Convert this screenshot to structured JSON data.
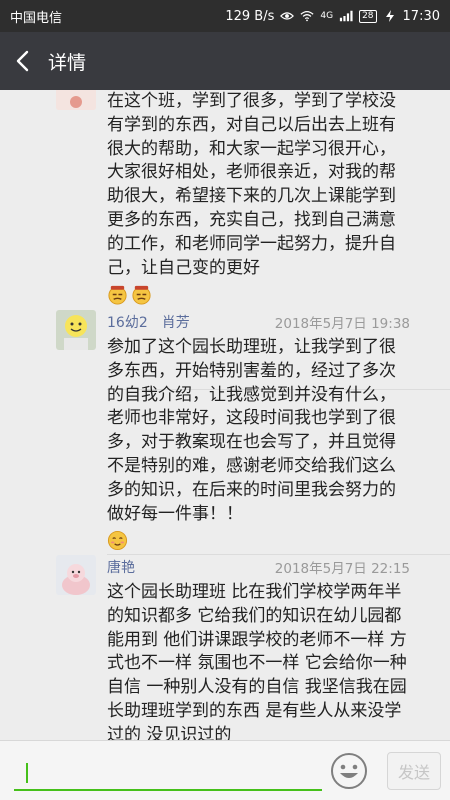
{
  "status_bar": {
    "carrier": "中国电信",
    "speed": "129 B/s",
    "network": "4G",
    "battery": "28",
    "time": "17:30"
  },
  "header": {
    "title": "详情",
    "back_icon": "chevron-left-icon"
  },
  "comments": [
    {
      "name": "",
      "time": "",
      "text": "在这个班，学到了很多，学到了学校没有学到的东西，对自己以后出去上班有很大的帮助，和大家一起学习很开心，大家很好相处，老师很亲近，对我的帮助很大，希望接下来的几次上课能学到更多的东西，充实自己，找到自己满意的工作，和老师同学一起努力，提升自己，让自己变的更好",
      "emojis": [
        "smirk-cowboy-emoji",
        "smirk-cowboy-emoji"
      ]
    },
    {
      "name": "16幼2　肖芳",
      "time": "2018年5月7日 19:38",
      "text": "参加了这个园长助理班，让我学到了很多东西，开始特别害羞的，经过了多次的自我介绍，让我感觉到并没有什么，老师也非常好，这段时间我也学到了很多，对于教案现在也会写了，并且觉得不是特别的难，感谢老师交给我们这么多的知识，在后来的时间里我会努力的做好每一件事！！",
      "emojis": [
        "blush-emoji"
      ]
    },
    {
      "name": "唐艳",
      "time": "2018年5月7日 22:15",
      "text": "这个园长助理班 比在我们学校学两年半的知识都多 它给我们的知识在幼儿园都能用到 他们讲课跟学校的老师不一样 方式也不一样 氛围也不一样 它会给你一种自信 一种别人没有的自信 我坚信我在园长助理班学到的东西 是有些人从来没学过的 没见识过的",
      "emojis": []
    }
  ],
  "input_bar": {
    "value": "",
    "emoji_icon": "smiley-icon",
    "send_label": "发送"
  },
  "colors": {
    "status_bar": "#2e2e2e",
    "header": "#393a3f",
    "background": "#ededed",
    "name": "#5b6d9c",
    "accent_green": "#45c01a"
  }
}
